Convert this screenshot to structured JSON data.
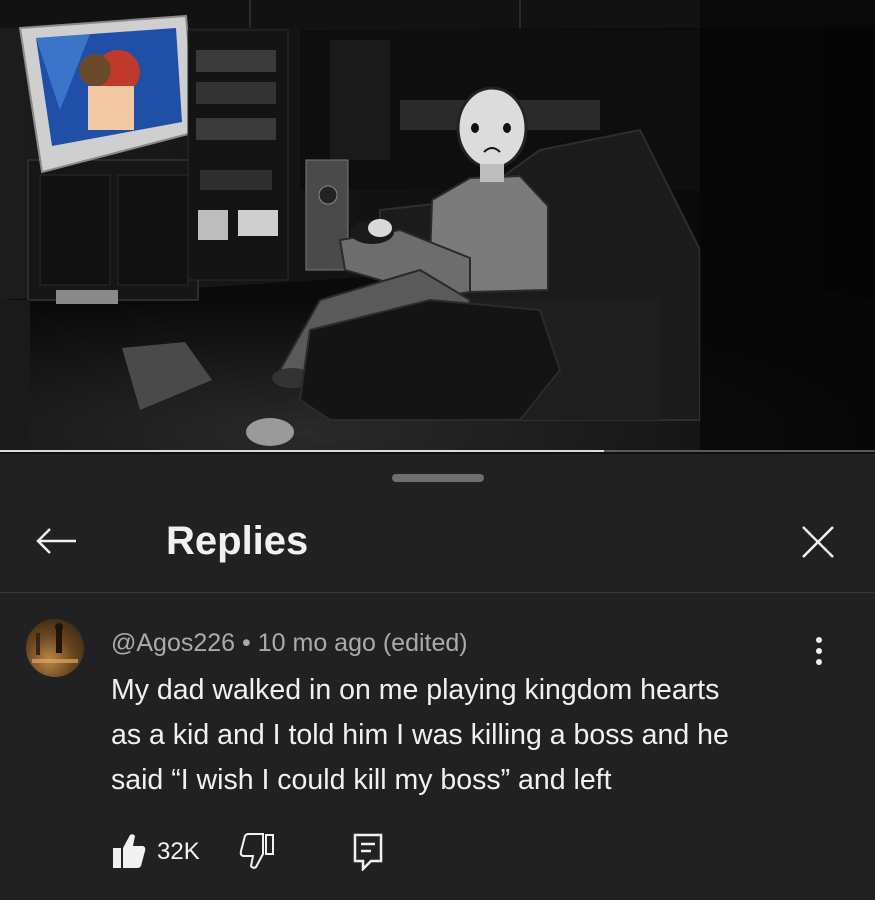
{
  "video": {
    "progress_fraction": 0.69
  },
  "replies_panel": {
    "title": "Replies",
    "back_icon": "arrow-left-icon",
    "close_icon": "close-icon"
  },
  "comment": {
    "author": "@Agos226",
    "separator": "•",
    "time": "10 mo ago (edited)",
    "text_lines": [
      "My dad walked in on me playing kingdom hearts",
      "as a kid and I told him I was killing a boss and he",
      "said “I wish I could kill my boss” and left"
    ],
    "like_count": "32K",
    "icons": {
      "like": "thumbs-up-icon",
      "dislike": "thumbs-down-icon",
      "reply": "reply-comment-icon",
      "more": "more-vertical-icon"
    }
  }
}
